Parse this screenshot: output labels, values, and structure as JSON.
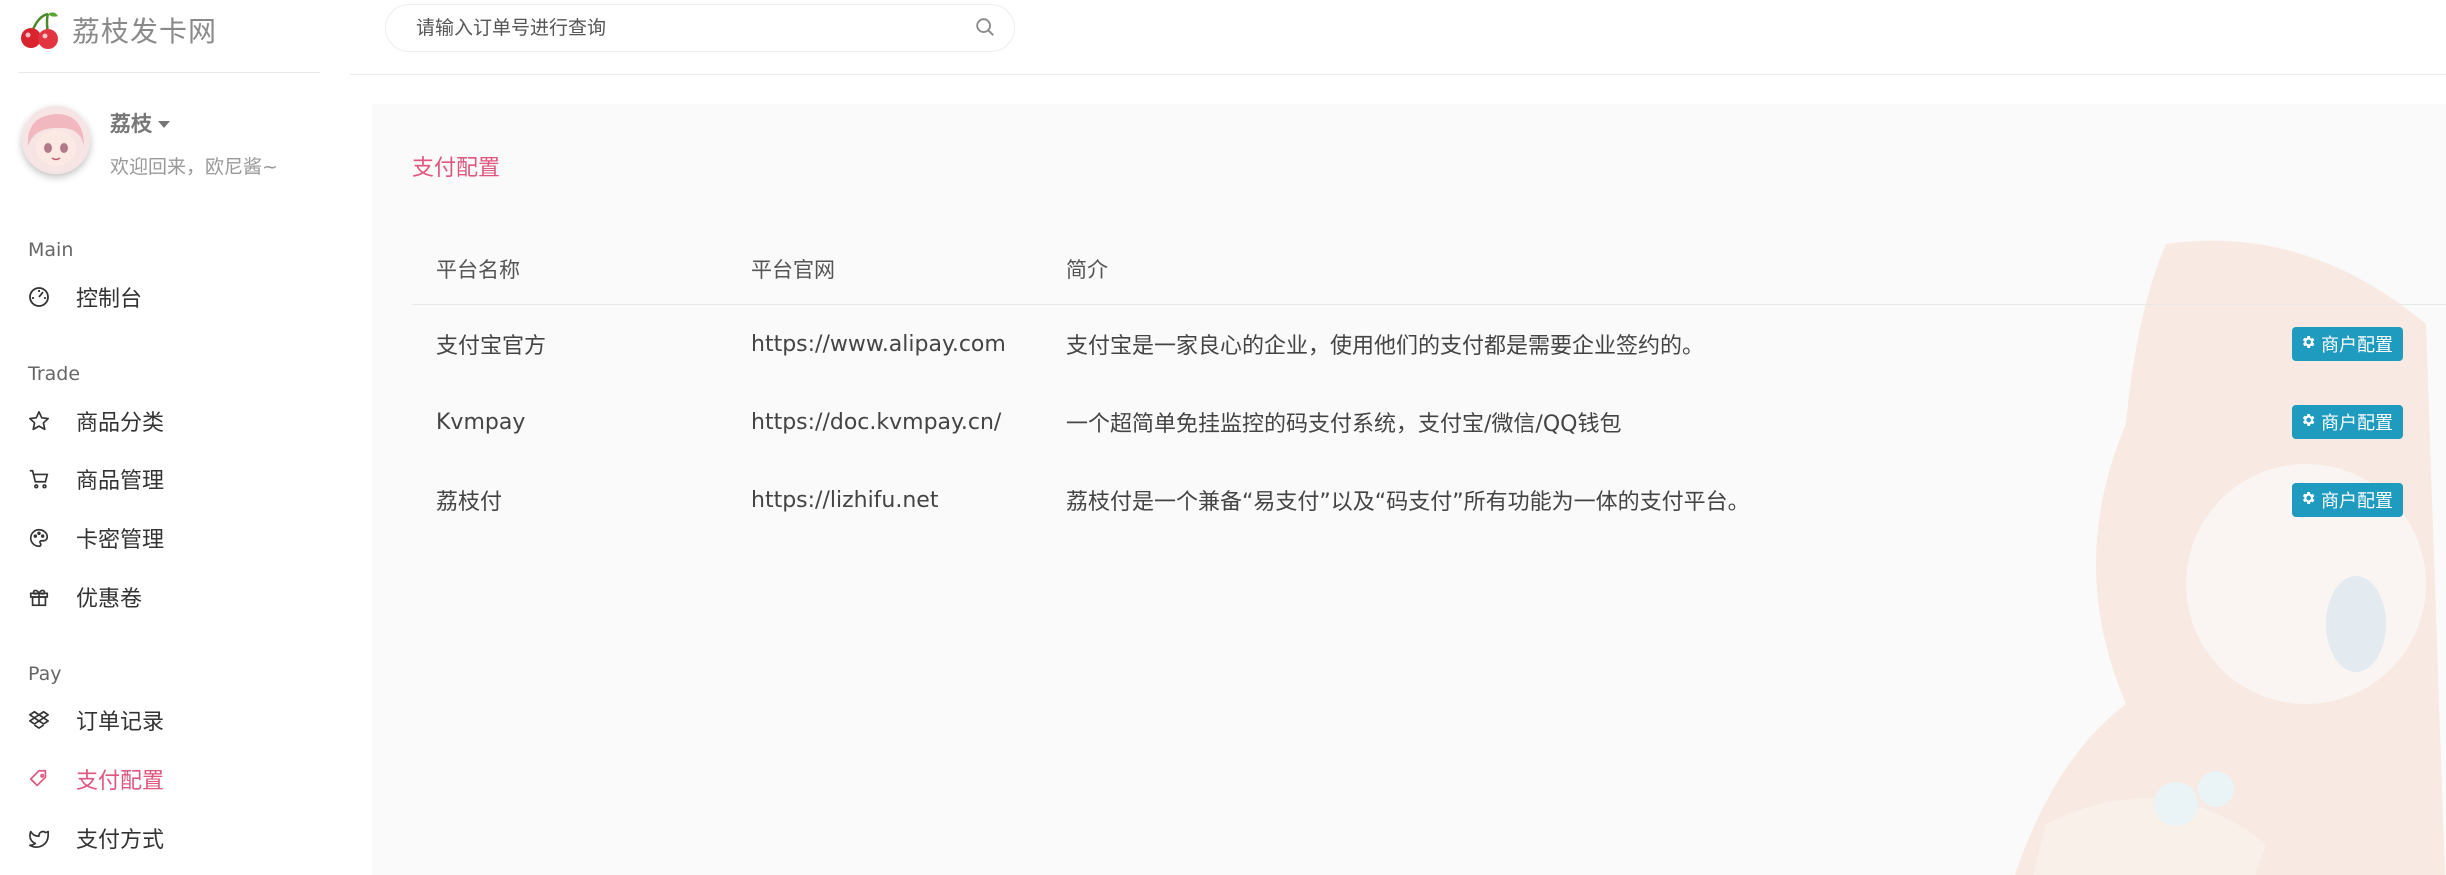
{
  "brand": {
    "title": "荔枝发卡网",
    "logo_icon": "cherry-icon"
  },
  "user": {
    "name": "荔枝",
    "greeting": "欢迎回来，欧尼酱~"
  },
  "search": {
    "placeholder": "请输入订单号进行查询"
  },
  "nav": {
    "sections": [
      {
        "label": "Main"
      },
      {
        "label": "Trade"
      },
      {
        "label": "Pay"
      }
    ],
    "items": [
      {
        "label": "控制台",
        "icon": "dashboard-icon"
      },
      {
        "label": "商品分类",
        "icon": "star-icon"
      },
      {
        "label": "商品管理",
        "icon": "cart-icon"
      },
      {
        "label": "卡密管理",
        "icon": "palette-icon"
      },
      {
        "label": "优惠卷",
        "icon": "gift-icon"
      },
      {
        "label": "订单记录",
        "icon": "dropbox-icon"
      },
      {
        "label": "支付配置",
        "icon": "tag-icon",
        "active": true
      },
      {
        "label": "支付方式",
        "icon": "twitter-icon"
      }
    ]
  },
  "main": {
    "title": "支付配置",
    "columns": [
      "平台名称",
      "平台官网",
      "简介"
    ],
    "rows": [
      {
        "name": "支付宝官方",
        "site": "https://www.alipay.com",
        "desc": "支付宝是一家良心的企业，使用他们的支付都是需要企业签约的。",
        "action": "商户配置"
      },
      {
        "name": "Kvmpay",
        "site": "https://doc.kvmpay.cn/",
        "desc": "一个超简单免挂监控的码支付系统，支付宝/微信/QQ钱包",
        "action": "商户配置"
      },
      {
        "name": "荔枝付",
        "site": "https://lizhifu.net",
        "desc": "荔枝付是一个兼备“易支付”以及“码支付”所有功能为一体的支付平台。",
        "action": "商户配置"
      }
    ]
  },
  "colors": {
    "accent": "#e0567f",
    "button": "#1e9bbf",
    "text": "#444444"
  }
}
